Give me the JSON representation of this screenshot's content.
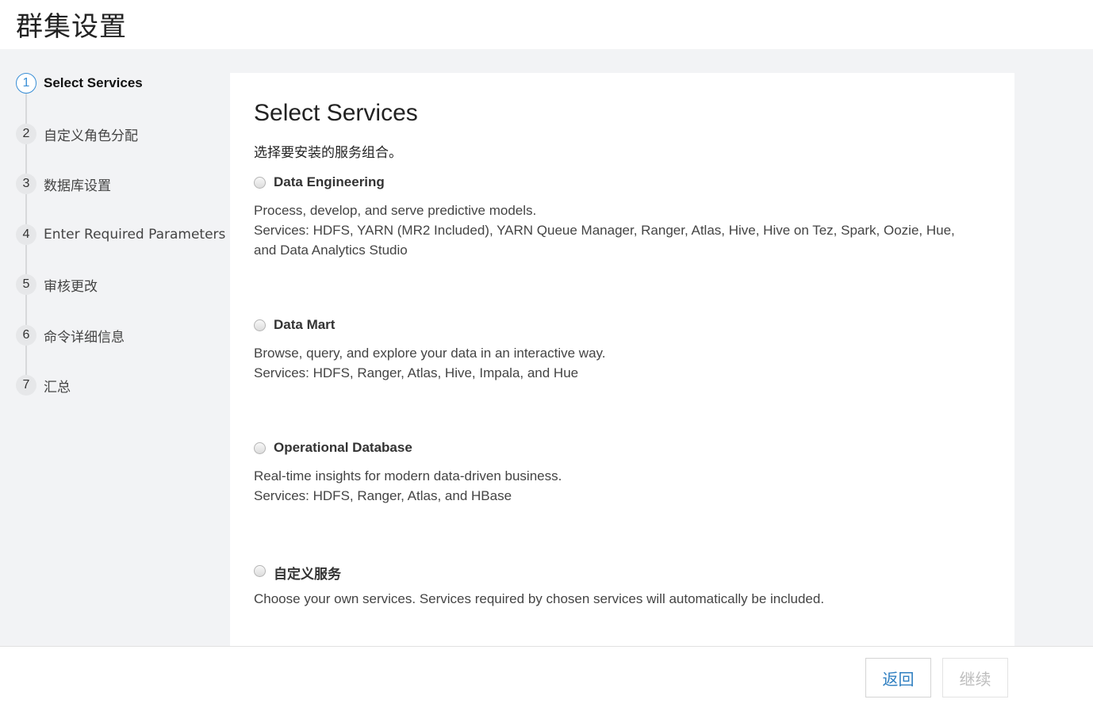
{
  "header": {
    "title": "群集设置"
  },
  "steps": [
    {
      "number": "1",
      "label": "Select Services",
      "active": true
    },
    {
      "number": "2",
      "label": "自定义角色分配"
    },
    {
      "number": "3",
      "label": "数据库设置"
    },
    {
      "number": "4",
      "label": "Enter Required Parameters"
    },
    {
      "number": "5",
      "label": "审核更改"
    },
    {
      "number": "6",
      "label": "命令详细信息"
    },
    {
      "number": "7",
      "label": "汇总"
    }
  ],
  "main": {
    "title": "Select Services",
    "subtitle": "选择要安装的服务组合。",
    "options": [
      {
        "name": "Data Engineering",
        "description": "Process, develop, and serve predictive models.",
        "services": "Services: HDFS, YARN (MR2 Included), YARN Queue Manager, Ranger, Atlas, Hive, Hive on Tez, Spark, Oozie, Hue, and Data Analytics Studio"
      },
      {
        "name": "Data Mart",
        "description": "Browse, query, and explore your data in an interactive way.",
        "services": "Services: HDFS, Ranger, Atlas, Hive, Impala, and Hue"
      },
      {
        "name": "Operational Database",
        "description": "Real-time insights for modern data-driven business.",
        "services": "Services: HDFS, Ranger, Atlas, and HBase"
      },
      {
        "name": "自定义服务",
        "description": "Choose your own services. Services required by chosen services will automatically be included."
      }
    ]
  },
  "footer": {
    "back_label": "返回",
    "continue_label": "继续"
  },
  "colors": {
    "accent": "#3a8fd6",
    "background": "#f2f3f5",
    "panel": "#ffffff"
  }
}
